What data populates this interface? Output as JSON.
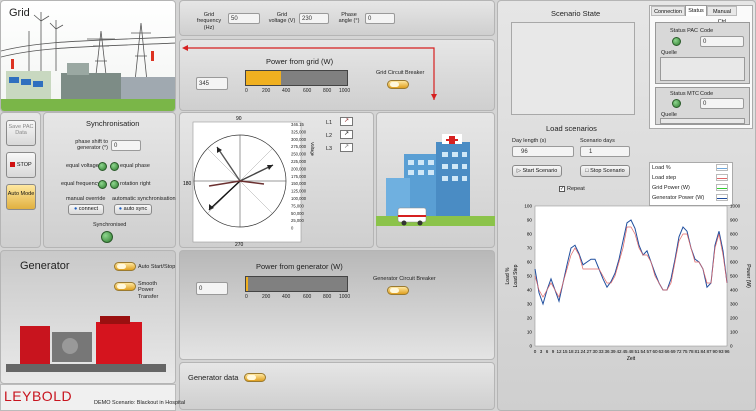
{
  "grid": {
    "title": "Grid",
    "frequency_label": "Grid frequency (Hz)",
    "frequency_value": "50",
    "voltage_label": "Grid voltage (V)",
    "voltage_value": "230",
    "phase_label": "Phase angle (°)",
    "phase_value": "0",
    "power_title": "Power from grid (W)",
    "power_value": "345",
    "power_fraction": 0.345,
    "breaker_label": "Grid Circuit Breaker"
  },
  "left_buttons": {
    "save_label": "Save PAC Data",
    "stop_label": "STOP",
    "auto_label": "Auto Mode"
  },
  "sync": {
    "title": "Synchronisation",
    "phase_shift_label": "phase shift to generator (°)",
    "phase_shift_value": "0",
    "equal_voltage": "equal voltage",
    "equal_phase": "equal phase",
    "equal_frequency": "equal frequency",
    "rotation_right": "rotation right",
    "manual_override": "manual override",
    "automatic_sync": "automatic synchronisation",
    "connect": "connect",
    "auto_sync": "auto sync",
    "synchronised": "Synchronised"
  },
  "phasor": {
    "top_tick": "90",
    "bottom_tick": "270",
    "left_tick": "180",
    "scale": [
      "346.15",
      "325,000",
      "300,000",
      "275,000",
      "250,000",
      "225,000",
      "200,000",
      "175,000",
      "150,000",
      "125,000",
      "100,000",
      "75,000",
      "50,000",
      "25,000",
      "0"
    ],
    "axis_label": "Voltage",
    "legend": [
      "L1",
      "L2",
      "L3"
    ]
  },
  "generator": {
    "title": "Generator",
    "auto_start_label": "Auto Start/Stop",
    "smooth_label": "Smooth Power Transfer",
    "power_title": "Power from generator (W)",
    "power_value": "0",
    "power_fraction": 0.0,
    "breaker_label": "Generator Circuit Breaker",
    "data_label": "Generator data"
  },
  "bar_ticks": [
    "0",
    "200",
    "400",
    "600",
    "800",
    "1000"
  ],
  "brand": {
    "logo": "LEYBOLD",
    "caption": "DEMO Scenario: Blackout in Hospital"
  },
  "scenario": {
    "state_title": "Scenario State",
    "load_title": "Load scenarios",
    "day_length_label": "Day length (s)",
    "day_length_value": "96",
    "scenario_days_label": "Scenario days",
    "scenario_days_value": "1",
    "start_label": "Start Scenario",
    "stop_label": "Stop Scenario",
    "repeat_label": "Repeat"
  },
  "status": {
    "tabs": [
      "Connection",
      "Status",
      "Manual Ctrl"
    ],
    "pac_status": "Status PAC",
    "pac_code_label": "Code",
    "pac_code_value": "0",
    "pac_source": "Quelle",
    "mtc_status": "Status MTC",
    "mtc_code_label": "Code",
    "mtc_code_value": "0",
    "mtc_source": "Quelle"
  },
  "chart_data": {
    "type": "line",
    "xlabel": "Zeit",
    "ylabel_left": "Load %",
    "ylabel_left2": "Load Step",
    "ylabel_right": "Power (W)",
    "xlim": [
      0,
      96
    ],
    "ylim_left": [
      0,
      100
    ],
    "ylim_right": [
      0,
      1000
    ],
    "x_ticks": [
      "0",
      "3",
      "6",
      "9",
      "12",
      "15",
      "18",
      "21",
      "24",
      "27",
      "30",
      "33",
      "36",
      "39",
      "42",
      "45",
      "48",
      "51",
      "54",
      "57",
      "60",
      "63",
      "66",
      "69",
      "72",
      "75",
      "78",
      "81",
      "84",
      "87",
      "90",
      "93",
      "96"
    ],
    "y_ticks_left": [
      "0",
      "10",
      "20",
      "30",
      "40",
      "50",
      "60",
      "70",
      "80",
      "90",
      "100"
    ],
    "y_ticks_right": [
      "0",
      "100",
      "200",
      "300",
      "400",
      "500",
      "600",
      "700",
      "800",
      "900",
      "1000"
    ],
    "legend": [
      {
        "name": "Load %",
        "color": "#6fa8dc"
      },
      {
        "name": "Load step",
        "color": "#e06666"
      },
      {
        "name": "Grid Power (W)",
        "color": "#33cc33"
      },
      {
        "name": "Generator Power (W)",
        "color": "#1f4e9e"
      }
    ],
    "series": [
      {
        "name": "Load %",
        "x": [
          0,
          2,
          4,
          6,
          8,
          10,
          12,
          14,
          16,
          18,
          20,
          22,
          24,
          26,
          28,
          30,
          32,
          34,
          36,
          38,
          40,
          42,
          44,
          46,
          48,
          50,
          52,
          54,
          56,
          58,
          60,
          62,
          64,
          66,
          68,
          70,
          72,
          74,
          76,
          78,
          80,
          82,
          84,
          86,
          88,
          90,
          92,
          94,
          96
        ],
        "y": [
          55,
          38,
          30,
          40,
          48,
          40,
          32,
          45,
          58,
          70,
          72,
          66,
          58,
          60,
          62,
          62,
          55,
          48,
          42,
          46,
          52,
          62,
          75,
          88,
          90,
          84,
          72,
          65,
          68,
          60,
          52,
          45,
          40,
          40,
          48,
          62,
          78,
          85,
          82,
          70,
          62,
          60,
          55,
          42,
          45,
          72,
          82,
          68,
          45
        ]
      },
      {
        "name": "Load step",
        "x": [
          0,
          2,
          4,
          6,
          8,
          10,
          12,
          14,
          16,
          18,
          20,
          22,
          24,
          26,
          28,
          30,
          32,
          34,
          36,
          38,
          40,
          42,
          44,
          46,
          48,
          50,
          52,
          54,
          56,
          58,
          60,
          62,
          64,
          66,
          68,
          70,
          72,
          74,
          76,
          78,
          80,
          82,
          84,
          86,
          88,
          90,
          92,
          94,
          96
        ],
        "y": [
          50,
          40,
          35,
          40,
          45,
          40,
          35,
          45,
          55,
          65,
          70,
          65,
          55,
          55,
          55,
          55,
          55,
          50,
          45,
          45,
          50,
          60,
          70,
          85,
          85,
          80,
          70,
          65,
          65,
          60,
          50,
          45,
          40,
          40,
          45,
          60,
          75,
          80,
          80,
          70,
          60,
          60,
          55,
          45,
          45,
          70,
          80,
          65,
          45
        ]
      }
    ]
  }
}
